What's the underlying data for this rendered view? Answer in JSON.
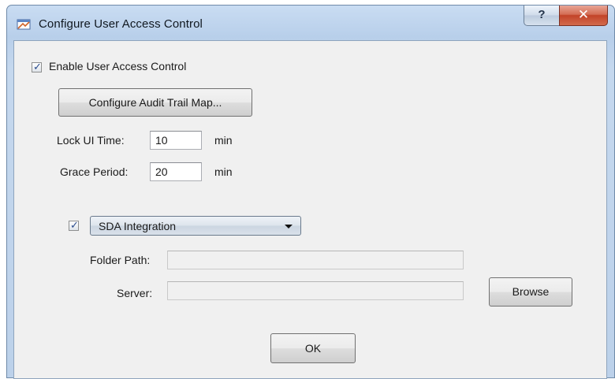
{
  "window": {
    "title": "Configure User Access Control",
    "help_label": "?",
    "close_label": "✕"
  },
  "uac": {
    "enable_label": "Enable User Access Control",
    "enable_checked": true,
    "audit_button": "Configure Audit Trail Map...",
    "lock_label": "Lock UI Time:",
    "lock_value": "10",
    "lock_unit": "min",
    "grace_label": "Grace Period:",
    "grace_value": "20",
    "grace_unit": "min"
  },
  "integration": {
    "checked": true,
    "selected": "SDA Integration",
    "folder_label": "Folder Path:",
    "folder_value": "",
    "server_label": "Server:",
    "server_value": "",
    "browse_label": "Browse"
  },
  "footer": {
    "ok_label": "OK"
  },
  "icons": {
    "app": "app-window-icon",
    "check": "check-mark-icon",
    "dropdown": "chevron-down-icon"
  }
}
